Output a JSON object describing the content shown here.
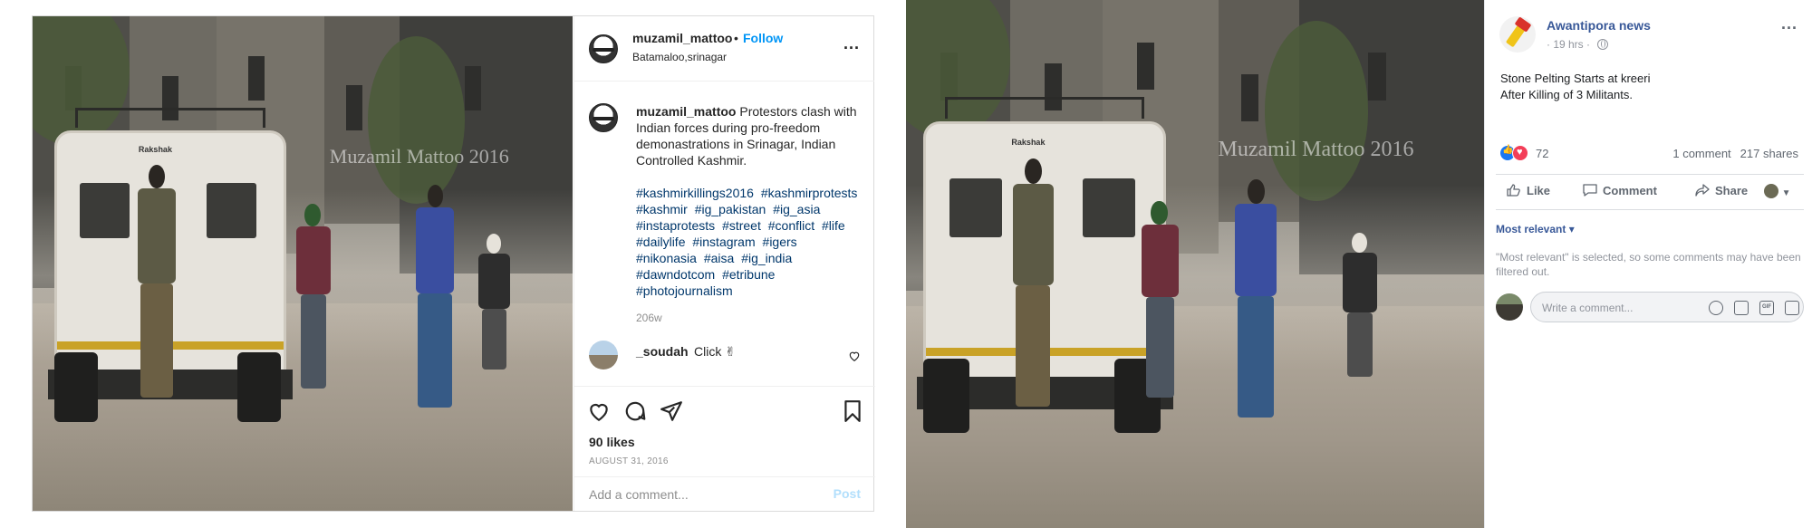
{
  "instagram": {
    "username": "muzamil_mattoo",
    "separator": "•",
    "follow_label": "Follow",
    "location": "Batamaloo,srinagar",
    "more_label": "...",
    "caption_user": "muzamil_mattoo",
    "caption_text": "Protestors clash with Indian forces during pro-freedom demonastrations in Srinagar, Indian Controlled Kashmir.",
    "hashtags": [
      "#kashmirkillings2016",
      "#kashmirprotests",
      "#kashmir",
      "#ig_pakistan",
      "#ig_asia",
      "#instaprotests",
      "#street",
      "#conflict",
      "#life",
      "#dailylife",
      "#instagram",
      "#igers",
      "#nikonasia",
      "#aisa",
      "#ig_india",
      "#dawndotcom",
      "#etribune",
      "#photojournalism"
    ],
    "age": "206w",
    "comment": {
      "user": "_soudah",
      "text": "Click ✌"
    },
    "likes": "90 likes",
    "date": "AUGUST 31, 2016",
    "add_comment_placeholder": "Add a comment...",
    "post_label": "Post",
    "photo": {
      "watermark": "Muzamil Mattoo 2016",
      "vehicle_label": "Rakshak"
    },
    "colors": {
      "link": "#0095f6",
      "hashtag": "#00376b",
      "post_disabled": "#b2dffc"
    }
  },
  "facebook": {
    "page_name": "Awantipora news",
    "time": "· 19 hrs ·",
    "more_label": "...",
    "post_lines": [
      "Stone Pelting Starts at kreeri",
      "After Killing of 3 Militants."
    ],
    "reaction_count": "72",
    "comments_count": "1 comment",
    "shares_count": "217 shares",
    "actions": {
      "like": "Like",
      "comment": "Comment",
      "share": "Share"
    },
    "sort_label": "Most relevant ▾",
    "sort_note": "\"Most relevant\" is selected, so some comments may have been filtered out.",
    "comment_placeholder": "Write a comment...",
    "photo": {
      "watermark": "Muzamil Mattoo 2016",
      "vehicle_label": "Rakshak"
    },
    "colors": {
      "link": "#385898",
      "like": "#1877f2",
      "love": "#f33e58"
    }
  }
}
